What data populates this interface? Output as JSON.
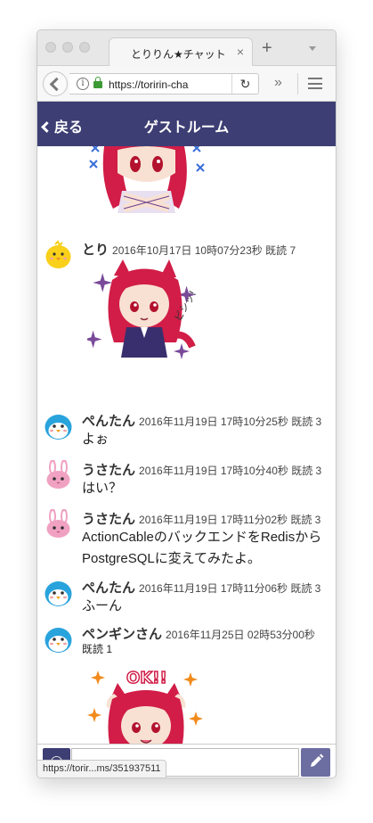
{
  "browser": {
    "tab_title": "とりりん★チャット",
    "tab_close": "×",
    "new_tab": "+",
    "url": "https://toririn-cha",
    "reload": "↻",
    "overflow": "»",
    "status_url": "https://torir...ms/351937511"
  },
  "app": {
    "back_label": "戻る",
    "title": "ゲストルーム"
  },
  "messages": [
    {
      "name": "とり",
      "meta": "2016年10月17日 10時07分23秒 既読 7",
      "text": "",
      "avatar": "chick-icon"
    },
    {
      "name": "ぺんたん",
      "meta": "2016年11月19日 17時10分25秒 既読 3",
      "text": "よぉ",
      "avatar": "penguin-icon"
    },
    {
      "name": "うさたん",
      "meta": "2016年11月19日 17時10分40秒 既読 3",
      "text": "はい？",
      "avatar": "rabbit-icon"
    },
    {
      "name": "うさたん",
      "meta": "2016年11月19日 17時11分02秒 既読 3",
      "text": "ActionCableのバックエンドをRedisからPostgreSQLに変えてみたよ。",
      "avatar": "rabbit-icon"
    },
    {
      "name": "ぺんたん",
      "meta": "2016年11月19日 17時11分06秒 既読 3",
      "text": "ふーん",
      "avatar": "penguin-icon"
    },
    {
      "name": "ペンギンさん",
      "meta": "2016年11月25日 02時53分00秒",
      "text": "既読 1",
      "avatar": "penguin-icon"
    }
  ],
  "stickers": {
    "ok_text": "OK!!",
    "sound_text": "ビシッ!"
  },
  "colors": {
    "header": "#3d3e73",
    "send": "#6c6da0",
    "hair": "#d11d47",
    "penguin": "#29a3dc",
    "rabbit": "#f0a1c2",
    "chick": "#f9d01a"
  }
}
